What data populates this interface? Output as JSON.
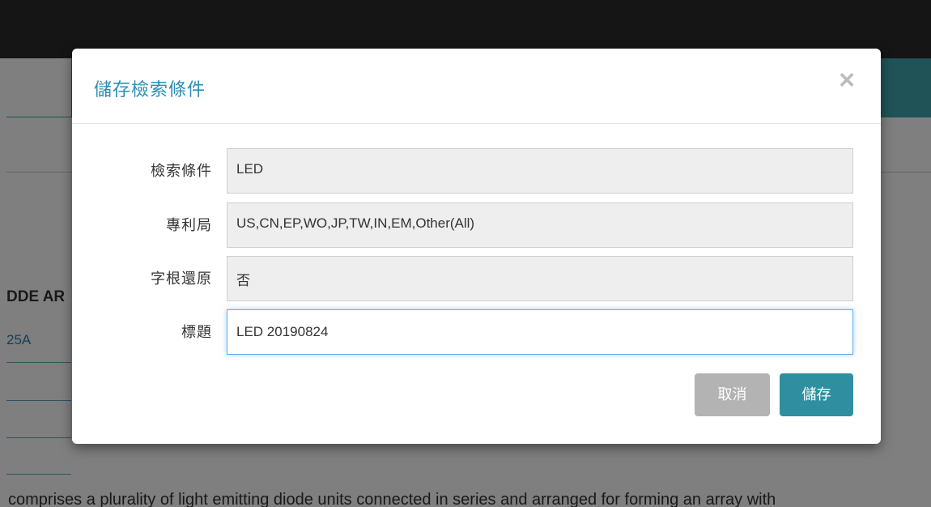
{
  "background": {
    "heading_fragment": "DDE AR",
    "link_fragment": "25A",
    "body_text_fragment": "comprises a plurality of light emitting diode units connected in series and arranged for forming an array with"
  },
  "modal": {
    "title": "儲存檢索條件",
    "close_label": "×",
    "fields": {
      "query": {
        "label": "檢索條件",
        "value": "LED"
      },
      "offices": {
        "label": "專利局",
        "value": "US,CN,EP,WO,JP,TW,IN,EM,Other(All)"
      },
      "stemming": {
        "label": "字根還原",
        "value": "否"
      },
      "title": {
        "label": "標題",
        "value": "LED 20190824"
      }
    },
    "buttons": {
      "cancel": "取消",
      "save": "儲存"
    }
  },
  "colors": {
    "accent": "#2a8fb5",
    "save_button": "#2f8fa0",
    "cancel_button": "#b3b3b3",
    "teal_bar": "#3fa6b1"
  }
}
